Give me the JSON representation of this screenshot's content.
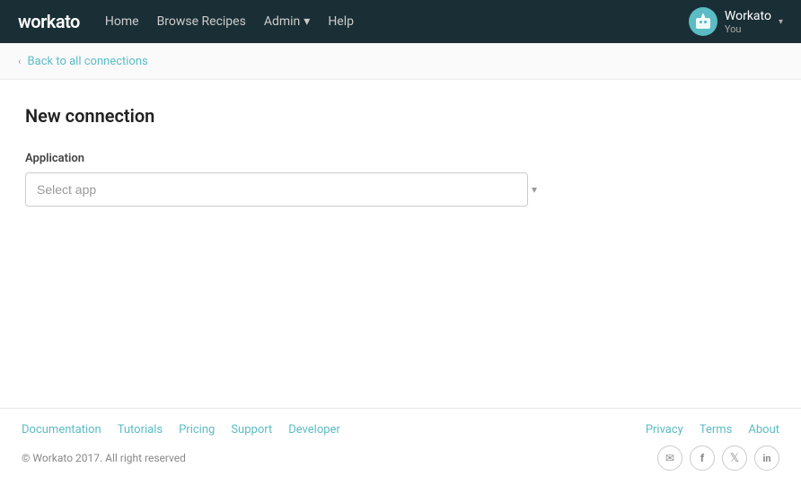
{
  "navbar": {
    "logo": "workato",
    "links": [
      {
        "label": "Home",
        "id": "home"
      },
      {
        "label": "Browse Recipes",
        "id": "browse-recipes"
      },
      {
        "label": "Admin",
        "id": "admin",
        "hasDropdown": true
      },
      {
        "label": "Help",
        "id": "help"
      }
    ],
    "user": {
      "name": "Workato",
      "sub": "You",
      "chevron": "▾"
    }
  },
  "breadcrumb": {
    "back_label": "Back to all connections",
    "arrow": "‹"
  },
  "page": {
    "title": "New connection"
  },
  "form": {
    "application_label": "Application",
    "select_placeholder": "Select app",
    "select_arrow": "▾"
  },
  "footer": {
    "links_left": [
      {
        "label": "Documentation",
        "id": "documentation"
      },
      {
        "label": "Tutorials",
        "id": "tutorials"
      },
      {
        "label": "Pricing",
        "id": "pricing"
      },
      {
        "label": "Support",
        "id": "support"
      },
      {
        "label": "Developer",
        "id": "developer"
      }
    ],
    "links_right": [
      {
        "label": "Privacy",
        "id": "privacy"
      },
      {
        "label": "Terms",
        "id": "terms"
      },
      {
        "label": "About",
        "id": "about"
      }
    ],
    "copyright": "© Workato 2017. All right reserved",
    "social": [
      {
        "icon": "✉",
        "id": "email-social"
      },
      {
        "icon": "f",
        "id": "facebook-social"
      },
      {
        "icon": "🐦",
        "id": "twitter-social"
      },
      {
        "icon": "in",
        "id": "linkedin-social"
      }
    ]
  }
}
